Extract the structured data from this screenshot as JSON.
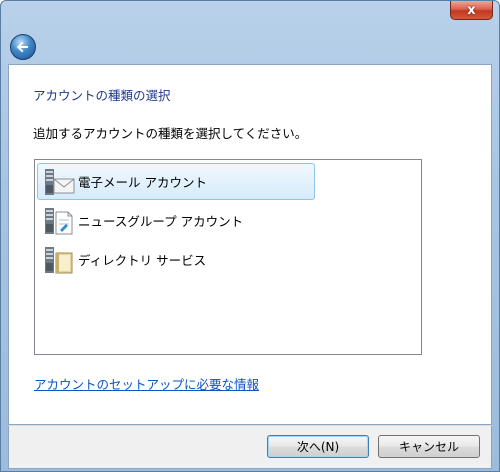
{
  "window": {
    "close_symbol": "x",
    "back_icon": "back-arrow-icon"
  },
  "page": {
    "heading": "アカウントの種類の選択",
    "instruction": "追加するアカウントの種類を選択してください。"
  },
  "account_types": [
    {
      "label": "電子メール アカウント",
      "icon": "email-account-icon",
      "selected": true
    },
    {
      "label": "ニュースグループ アカウント",
      "icon": "newsgroup-account-icon",
      "selected": false
    },
    {
      "label": "ディレクトリ サービス",
      "icon": "directory-service-icon",
      "selected": false
    }
  ],
  "help_link": "アカウントのセットアップに必要な情報",
  "buttons": {
    "next": "次へ(N)",
    "cancel": "キャンセル"
  },
  "colors": {
    "heading": "#1e3a8a",
    "link": "#0b55c4",
    "selection": "#d5ebfb"
  }
}
